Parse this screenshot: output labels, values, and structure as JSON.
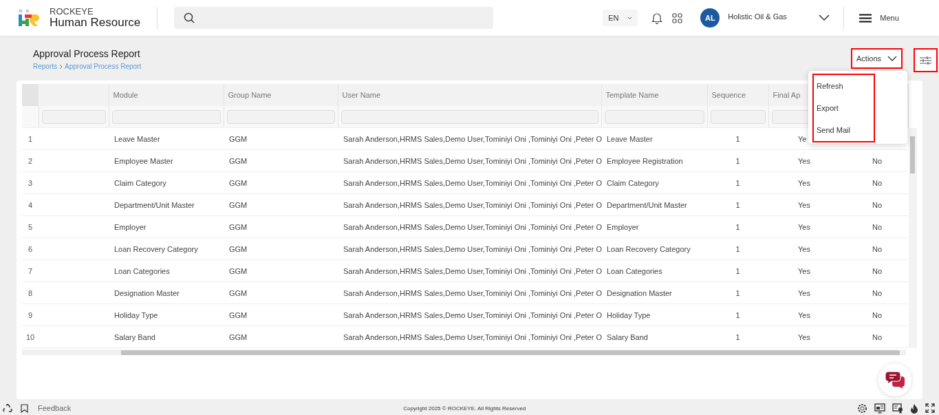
{
  "header": {
    "brand_top": "ROCKEYE",
    "brand_bottom": "Human Resource",
    "language": "EN",
    "company_initials": "AL",
    "company": "Holistic Oil & Gas",
    "menu_label": "Menu"
  },
  "page": {
    "title": "Approval Process Report",
    "breadcrumb": [
      "Reports",
      "Approval Process Report"
    ],
    "actions_label": "Actions",
    "actions_menu": [
      "Refresh",
      "Export",
      "Send Mail"
    ]
  },
  "table": {
    "columns": [
      "Module",
      "Group Name",
      "User Name",
      "Template Name",
      "Sequence",
      "Final Ap"
    ],
    "rows": [
      {
        "number": "1",
        "module": "Leave Master",
        "group": "GGM",
        "users": "Sarah Anderson,HRMS Sales,Demo User,Tominiyi Oni ,Tominiyi Oni ,Peter O",
        "template": "Leave Master",
        "sequence": "1",
        "final": "Ye"
      },
      {
        "number": "2",
        "module": "Employee Master",
        "group": "GGM",
        "users": "Sarah Anderson,HRMS Sales,Demo User,Tominiyi Oni ,Tominiyi Oni ,Peter O",
        "template": "Employee Registration",
        "sequence": "1",
        "final": "Yes",
        "column_8": "No"
      },
      {
        "number": "3",
        "module": "Claim Category",
        "group": "GGM",
        "users": "Sarah Anderson,HRMS Sales,Demo User,Tominiyi Oni ,Tominiyi Oni ,Peter O",
        "template": "Claim Category",
        "sequence": "1",
        "final": "Yes",
        "column_8": "No"
      },
      {
        "number": "4",
        "module": "Department/Unit Master",
        "group": "GGM",
        "users": "Sarah Anderson,HRMS Sales,Demo User,Tominiyi Oni ,Tominiyi Oni ,Peter O",
        "template": "Department/Unit Master",
        "sequence": "1",
        "final": "Yes",
        "column_8": "No"
      },
      {
        "number": "5",
        "module": "Employer",
        "group": "GGM",
        "users": "Sarah Anderson,HRMS Sales,Demo User,Tominiyi Oni ,Tominiyi Oni ,Peter O",
        "template": "Employer",
        "sequence": "1",
        "final": "Yes",
        "column_8": "No"
      },
      {
        "number": "6",
        "module": "Loan Recovery Category",
        "group": "GGM",
        "users": "Sarah Anderson,HRMS Sales,Demo User,Tominiyi Oni ,Tominiyi Oni ,Peter O",
        "template": "Loan Recovery Category",
        "sequence": "1",
        "final": "Yes",
        "column_8": "No"
      },
      {
        "number": "7",
        "module": "Loan Categories",
        "group": "GGM",
        "users": "Sarah Anderson,HRMS Sales,Demo User,Tominiyi Oni ,Tominiyi Oni ,Peter O",
        "template": "Loan Categories",
        "sequence": "1",
        "final": "Yes",
        "column_8": "No"
      },
      {
        "number": "8",
        "module": "Designation Master",
        "group": "GGM",
        "users": "Sarah Anderson,HRMS Sales,Demo User,Tominiyi Oni ,Tominiyi Oni ,Peter O",
        "template": "Designation Master",
        "sequence": "1",
        "final": "Yes",
        "column_8": "No"
      },
      {
        "number": "9",
        "module": "Holiday Type",
        "group": "GGM",
        "users": "Sarah Anderson,HRMS Sales,Demo User,Tominiyi Oni ,Tominiyi Oni ,Peter O",
        "template": "Holiday Type",
        "sequence": "1",
        "final": "Yes",
        "column_8": "No"
      },
      {
        "number": "10",
        "module": "Salary Band",
        "group": "GGM",
        "users": "Sarah Anderson,HRMS Sales,Demo User,Tominiyi Oni ,Tominiyi Oni ,Peter O",
        "template": "Salary Band",
        "sequence": "1",
        "final": "Yes",
        "column_8": "No"
      }
    ]
  },
  "footer": {
    "feedback": "Feedback",
    "copyright": "Copyright 2025 © ROCKEYE. All Rights Reserved"
  }
}
